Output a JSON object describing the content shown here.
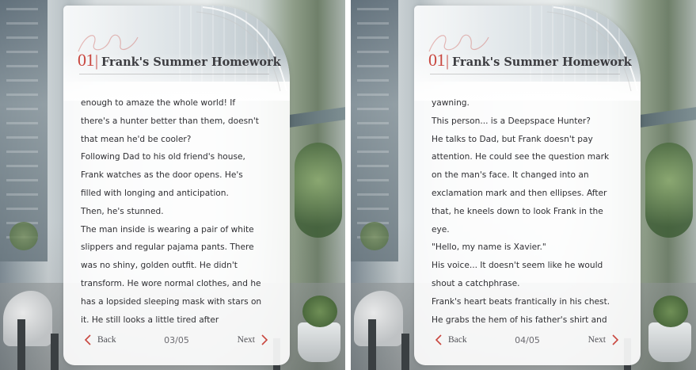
{
  "screens": [
    {
      "chapter_number": "01",
      "title_separator": "|",
      "chapter_title": "Frank's Summer Homework",
      "lines": [
        "enough to amaze the whole world! If",
        "there's a hunter better than them, doesn't",
        "that mean he'd be cooler?",
        "Following Dad to his old friend's house,",
        "Frank watches as the door opens. He's",
        "filled with longing and anticipation.",
        "Then, he's stunned.",
        "The man inside is wearing a pair of white",
        "slippers and regular pajama pants. There",
        "was no shiny, golden outfit. He didn't",
        "transform. He wore normal clothes, and he",
        "has a lopsided sleeping mask with stars on",
        "it. He still looks a little tired after"
      ],
      "back_label": "Back",
      "page_indicator": "03/05",
      "next_label": "Next"
    },
    {
      "chapter_number": "01",
      "title_separator": "|",
      "chapter_title": "Frank's Summer Homework",
      "lines": [
        "yawning.",
        "This person... is a Deepspace Hunter?",
        "He talks to Dad, but Frank doesn't pay",
        "attention. He could see the question mark",
        "on the man's face. It changed into an",
        "exclamation mark and then ellipses. After",
        "that, he kneels down to look Frank in the",
        "eye.",
        "\"Hello, my name is Xavier.\"",
        "His voice... It doesn't seem like he would",
        "shout a catchphrase.",
        "Frank's heart beats frantically in his chest.",
        "He grabs the hem of his father's shirt and"
      ],
      "back_label": "Back",
      "page_indicator": "04/05",
      "next_label": "Next"
    }
  ],
  "colors": {
    "accent": "#c9473f",
    "title_text": "#3c3c40",
    "body_text": "#2f2f33"
  },
  "icons": {
    "back": "chevron-left-icon",
    "next": "chevron-right-icon"
  }
}
